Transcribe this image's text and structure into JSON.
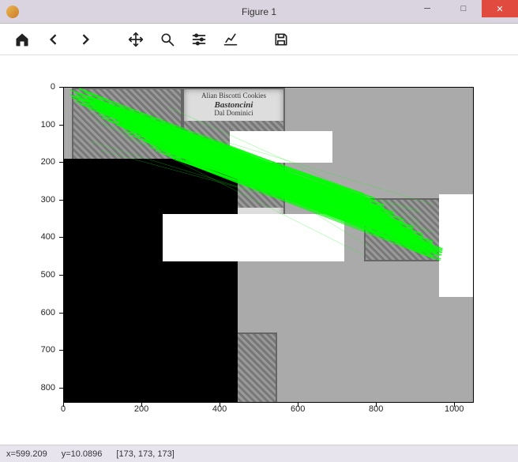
{
  "window": {
    "title": "Figure 1",
    "buttons": {
      "min": "─",
      "max": "□",
      "close": "✕"
    }
  },
  "toolbar": {
    "home": "Home",
    "back": "Back",
    "forward": "Forward",
    "pan": "Pan",
    "zoom": "Zoom",
    "subplots": "Configure subplots",
    "edit": "Customize",
    "save": "Save"
  },
  "axes": {
    "y_ticks": [
      "0",
      "100",
      "200",
      "300",
      "400",
      "500",
      "600",
      "700",
      "800"
    ],
    "x_ticks": [
      "0",
      "200",
      "400",
      "600",
      "800",
      "1000"
    ],
    "x_range": [
      0,
      1050
    ],
    "y_range": [
      0,
      840
    ]
  },
  "packages": {
    "brand": "Bastoncini",
    "subtitle_top": "Alian Biscotti Cookies",
    "subtitle_small": "Dal Dominici"
  },
  "matches": {
    "color": "#00ff00",
    "count_approx": 180
  },
  "status": {
    "x_label": "x=",
    "x_val": "599.209",
    "y_label": "y=",
    "y_val": "10.0896",
    "pixel": "[173, 173, 173]"
  }
}
